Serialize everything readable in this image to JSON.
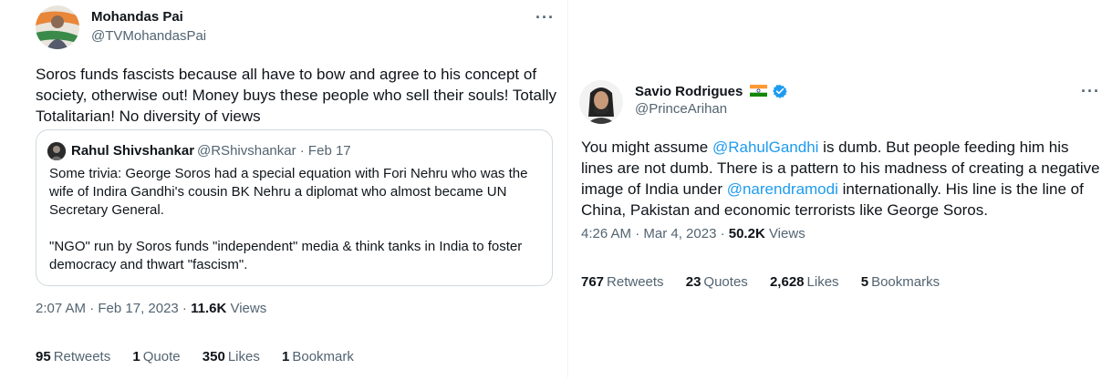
{
  "left_tweet": {
    "author_name": "Mohandas Pai",
    "author_handle": "@TVMohandasPai",
    "text": "Soros funds fascists because all have to bow and agree to his concept of society, otherwise out! Money buys these people who sell their souls! Totally Totalitarian! No diversity of views",
    "quote": {
      "author_name": "Rahul Shivshankar",
      "author_handle": "@RShivshankar · Feb 17",
      "paragraph1": "Some trivia: George Soros had a special equation with Fori Nehru who was the wife of Indira Gandhi's cousin BK Nehru a diplomat who almost became UN Secretary General.",
      "paragraph2": "\"NGO\" run by Soros funds \"independent\" media & think tanks in India to foster democracy and thwart \"fascism\"."
    },
    "timestamp": "2:07 AM · Feb 17, 2023 · ",
    "views_count": "11.6K",
    "views_label": " Views",
    "stats": {
      "retweets_count": "95",
      "retweets_label": "Retweets",
      "quotes_count": "1",
      "quotes_label": "Quote",
      "likes_count": "350",
      "likes_label": "Likes",
      "bookmarks_count": "1",
      "bookmarks_label": "Bookmark"
    }
  },
  "right_tweet": {
    "author_name": "Savio Rodrigues",
    "author_handle": "@PrinceArihan",
    "text_1": "You might assume ",
    "mention_1": "@RahulGandhi",
    "text_2": " is dumb. But people feeding him his lines are not dumb. There is a pattern to his madness of creating a negative image of India under ",
    "mention_2": "@narendramodi",
    "text_3": " internationally. His line is the line of China, Pakistan and economic terrorists like George Soros.",
    "timestamp": "4:26 AM · Mar 4, 2023 · ",
    "views_count": "50.2K",
    "views_label": " Views",
    "stats": {
      "retweets_count": "767",
      "retweets_label": "Retweets",
      "quotes_count": "23",
      "quotes_label": "Quotes",
      "likes_count": "2,628",
      "likes_label": "Likes",
      "bookmarks_count": "5",
      "bookmarks_label": "Bookmarks"
    }
  },
  "more_menu_glyph": "···",
  "icons": [
    "india-flag-icon",
    "verified-badge-icon",
    "more-options-icon"
  ],
  "colors": {
    "link": "#1d9bf0",
    "secondary_text": "#536471",
    "verified": "#1d9bf0"
  }
}
